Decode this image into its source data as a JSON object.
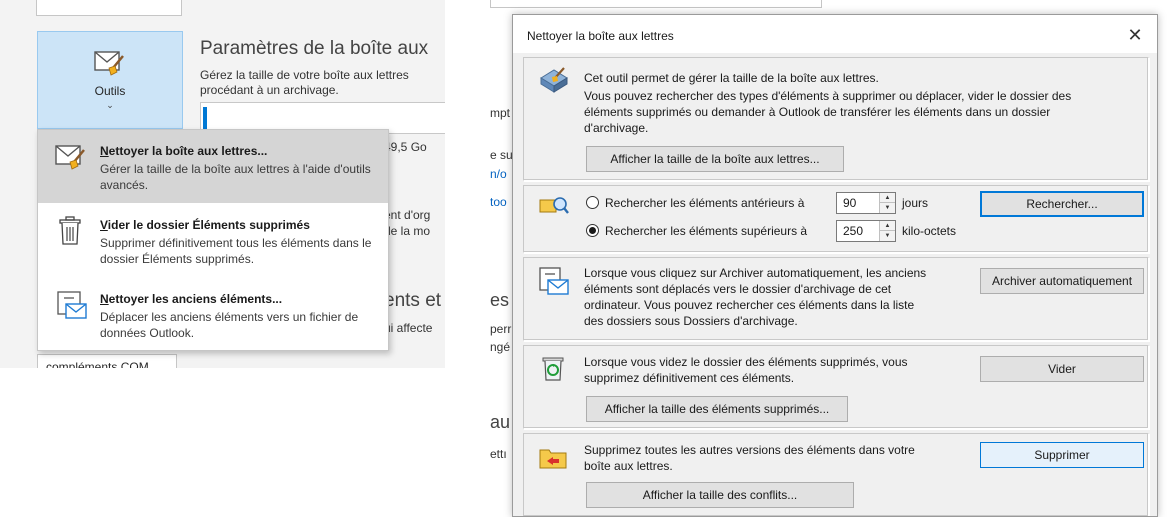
{
  "left_panel": {
    "tools_button": {
      "label": "Outils"
    },
    "settings_title": "Paramètres de la boîte aux",
    "settings_desc": [
      "Gérez la taille de votre boîte aux lettres",
      "procédant à un archivage."
    ],
    "background": {
      "size_text": "49,5 Go",
      "frag1": "ent d'org",
      "frag2": "de la mo",
      "title2": "ents et",
      "frag3": "ui affecte"
    },
    "com_box_text": "compléments COM",
    "menu": [
      {
        "title": "Nettoyer la boîte aux lettres...",
        "accel": "N",
        "rest": "ettoyer la boîte aux lettres...",
        "desc": "Gérer la taille de la boîte aux lettres à l'aide d'outils avancés.",
        "icon": "mailbox-cleanup-icon"
      },
      {
        "title": "Vider le dossier Éléments supprimés",
        "accel": "V",
        "rest": "ider le dossier Éléments supprimés",
        "desc": "Supprimer définitivement tous les éléments dans le dossier Éléments supprimés.",
        "icon": "trash-can-icon"
      },
      {
        "title": "Nettoyer les anciens éléments...",
        "accel": "N",
        "rest": "ettoyer les anciens éléments...",
        "desc": "Déplacer les anciens éléments vers un fichier de données Outlook.",
        "icon": "archive-icon"
      }
    ]
  },
  "background_fragments": [
    "mpt",
    "e su",
    "n/o",
    "too",
    "es (",
    "perr",
    "ngé",
    "au",
    "ettı"
  ],
  "dialog": {
    "title": "Nettoyer la boîte aux lettres",
    "close_symbol": "✕",
    "section1": {
      "line1": "Cet outil permet de gérer la taille de la boîte aux lettres.",
      "line2": "Vous pouvez rechercher des types d'éléments à supprimer ou déplacer, vider le dossier des",
      "line3": "éléments supprimés ou demander à Outlook de transférer les éléments dans un dossier",
      "line4": "d'archivage.",
      "button": "Afficher la taille de la boîte aux lettres..."
    },
    "section2": {
      "radio1_label": "Rechercher les éléments antérieurs à",
      "radio1_value": "90",
      "radio1_unit": "jours",
      "radio2_label": "Rechercher les éléments supérieurs à",
      "radio2_value": "250",
      "radio2_unit": "kilo-octets",
      "button": "Rechercher..."
    },
    "section3": {
      "line1": "Lorsque vous cliquez sur Archiver automatiquement, les anciens",
      "line2": "éléments sont déplacés vers le dossier d'archivage de cet",
      "line3": "ordinateur. Vous pouvez rechercher ces éléments dans la liste",
      "line4": "des dossiers sous Dossiers d'archivage.",
      "button": "Archiver automatiquement"
    },
    "section4": {
      "line1": "Lorsque vous videz le dossier des éléments supprimés, vous",
      "line2": "supprimez définitivement ces éléments.",
      "button": "Vider",
      "size_button": "Afficher la taille des éléments supprimés..."
    },
    "section5": {
      "line1": "Supprimez toutes les autres versions des éléments dans votre",
      "line2": "boîte aux lettres.",
      "button": "Supprimer",
      "size_button": "Afficher la taille des conflits..."
    }
  },
  "colors": {
    "accent": "#0078d4",
    "selected_tile": "#cce4f7",
    "menu_highlight": "#d5d5d5",
    "dialog_bg": "#f0f0f0"
  }
}
